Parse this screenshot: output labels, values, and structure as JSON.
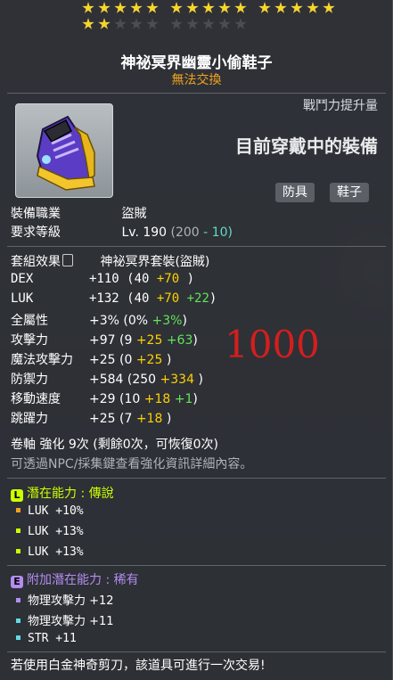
{
  "stars": {
    "filled": 17,
    "total": 25
  },
  "item": {
    "name": "神祕冥界幽靈小偷鞋子",
    "trade_status": "無法交換",
    "power_label": "戰鬥力提升量",
    "power_status": "目前穿戴中的裝備",
    "tags": [
      "防具",
      "鞋子"
    ],
    "icon": "purple-shoe-icon"
  },
  "requirements": {
    "job_label": "裝備職業",
    "job_value": "盜賊",
    "level_label": "要求等級",
    "level_value": "Lv. 190",
    "level_base": "(200",
    "level_reduce": "- 10)"
  },
  "set": {
    "label": "套組效果",
    "value": "神祕冥界套裝(盜賊)"
  },
  "stats": [
    {
      "name": "DEX",
      "total": "+110",
      "base": "(40",
      "p1": "+70",
      "p2": "",
      "p3": ")"
    },
    {
      "name": "LUK",
      "total": "+132",
      "base": "(40",
      "p1": "+70",
      "p2": "+22",
      "p3": ")"
    },
    {
      "name": "全屬性",
      "total": "+3%",
      "base": "(0%",
      "p1": "",
      "p2": "+3%",
      "p3": ")"
    },
    {
      "name": "攻擊力",
      "total": "+97",
      "base": "(9",
      "p1": "+25",
      "p2": "+63",
      "p3": ")"
    },
    {
      "name": "魔法攻擊力",
      "total": "+25",
      "base": "(0",
      "p1": "+25",
      "p2": "",
      "p3": ")"
    },
    {
      "name": "防禦力",
      "total": "+584",
      "base": "(250",
      "p1": "+334",
      "p2": "",
      "p3": ")"
    },
    {
      "name": "移動速度",
      "total": "+29",
      "base": "(10",
      "p1": "+18",
      "p2": "+1",
      "p3": ")"
    },
    {
      "name": "跳躍力",
      "total": "+25",
      "base": "(7",
      "p1": "+18",
      "p2": "",
      "p3": ")"
    }
  ],
  "overlay_number": "1000",
  "scroll": {
    "line": "卷軸 強化 9次 (剩餘0次，可恢復0次)",
    "hint": "可透過NPC/採集鍵查看強化資訊詳細內容。"
  },
  "potential": {
    "title": "潛在能力 : 傳說",
    "badge": "L",
    "lines": [
      "LUK +10%",
      "LUK +13%",
      "LUK +13%"
    ]
  },
  "additional": {
    "title": "附加潛在能力 : 稀有",
    "badge": "E",
    "lines": [
      "物理攻擊力 +12",
      "物理攻擊力 +11",
      "STR +11"
    ]
  },
  "footer": "若使用白金神奇剪刀，該道具可進行一次交易!",
  "colors": {
    "star": "#f6d52d",
    "legendary": "#ccff00",
    "epic": "#b48cf0",
    "bonus": "#a9a4f5"
  }
}
